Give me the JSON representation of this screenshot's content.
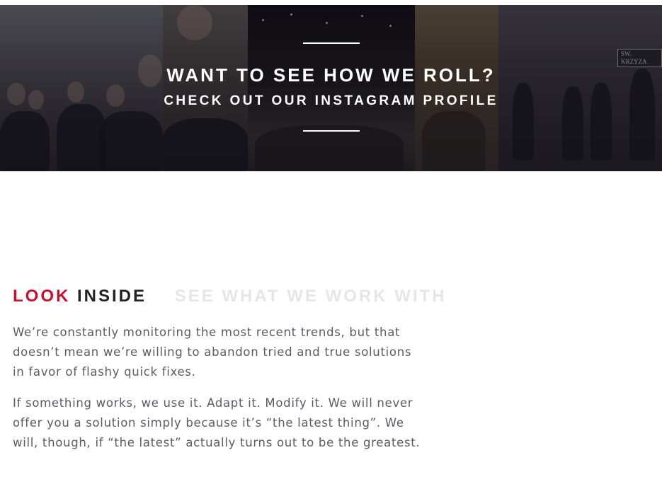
{
  "banner": {
    "title": "WANT TO SEE HOW WE ROLL?",
    "subtitle": "CHECK OUT OUR INSTAGRAM PROFILE",
    "street_sign": "SW. KRZYZA"
  },
  "tabs": {
    "active_word_1": "LOOK",
    "active_word_2": "INSIDE",
    "inactive": "SEE WHAT WE WORK WITH"
  },
  "content": {
    "paragraphs": [
      "We’re constantly monitoring the most recent trends, but that doesn’t mean we’re willing to abandon tried and true solutions in favor of flashy quick fixes.",
      "If something works, we use it. Adapt it. Modify it. We will never offer you a solution simply because it’s “the latest thing”. We will, though, if “the latest” actually turns out to be the greatest."
    ]
  },
  "colors": {
    "accent": "#c8102e",
    "heading_dark": "#222226",
    "inactive_tab": "#e6e6e8",
    "body_text": "#5b5b63"
  }
}
